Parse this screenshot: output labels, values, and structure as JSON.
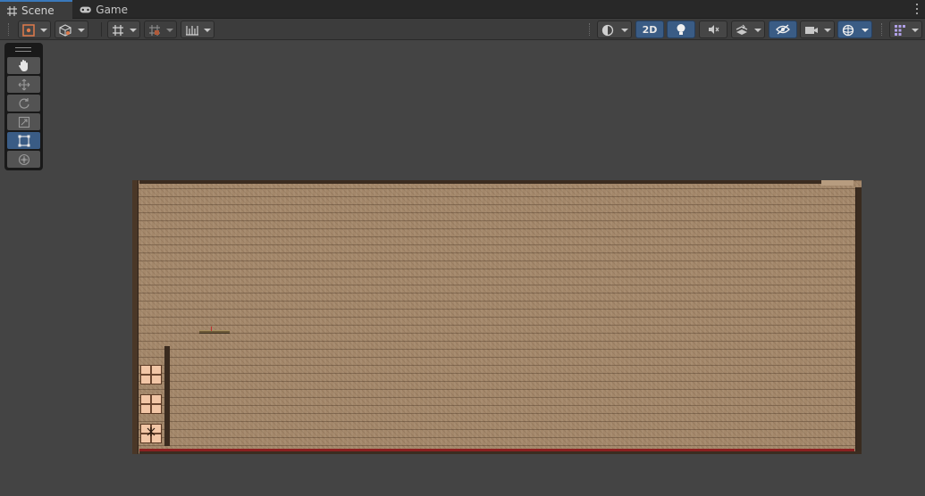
{
  "tabs": [
    {
      "label": "Scene",
      "icon": "grid-icon",
      "active": true
    },
    {
      "label": "Game",
      "icon": "gamepad-icon",
      "active": false
    }
  ],
  "toolbar": {
    "left": [
      "draw-mode-icon",
      "shading-cube-icon",
      "grid-snap-icon",
      "increment-snap-icon",
      "ruler-icon"
    ],
    "right": [
      "render-sphere-icon",
      "lighting-bulb-icon",
      "audio-mute-icon",
      "effects-layers-icon",
      "visibility-hidden-icon",
      "camera-icon",
      "gizmos-icon",
      "component-grid-icon"
    ],
    "mode_2d_label": "2D",
    "mode_2d_enabled": true,
    "lighting_enabled": true,
    "visibility_enabled": true,
    "gizmos_enabled": true
  },
  "tool_palette": {
    "tools": [
      "hand-tool-icon",
      "move-tool-icon",
      "rotate-tool-icon",
      "scale-tool-icon",
      "rect-tool-icon",
      "transform-tool-icon"
    ],
    "selected": "rect-tool-icon"
  },
  "colors": {
    "accent": "#3a79bb",
    "selected": "#3a5c85",
    "scene_bg": "#444444",
    "wood": "#a3876a",
    "floor_line": "#8b2020",
    "crate": "#f2c6a6"
  }
}
